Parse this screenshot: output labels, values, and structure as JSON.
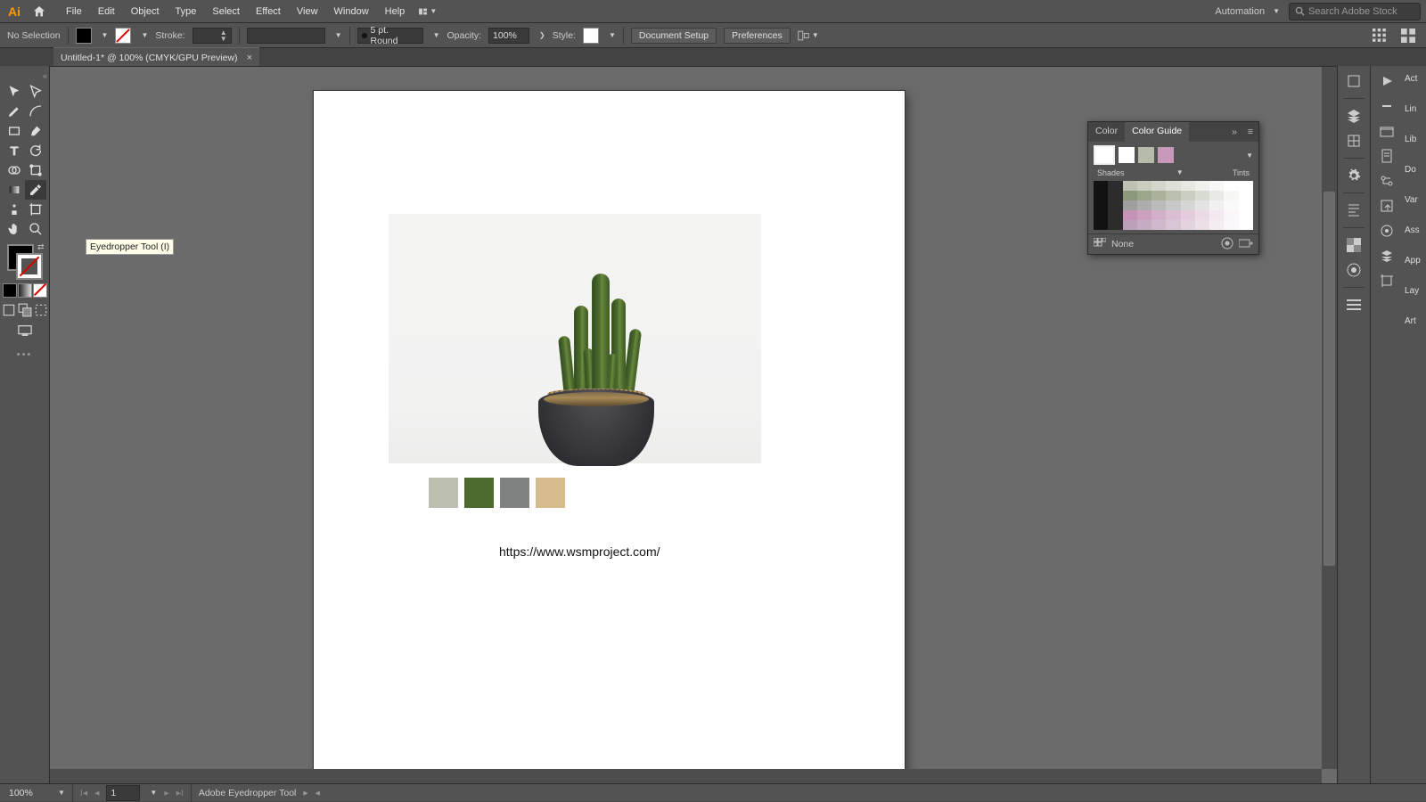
{
  "menubar": {
    "items": [
      "File",
      "Edit",
      "Object",
      "Type",
      "Select",
      "Effect",
      "View",
      "Window",
      "Help"
    ],
    "automation": "Automation",
    "search_placeholder": "Search Adobe Stock"
  },
  "controlbar": {
    "selection": "No Selection",
    "stroke_label": "Stroke:",
    "stroke_weight": "",
    "brush_profile": "5 pt. Round",
    "opacity_label": "Opacity:",
    "opacity_value": "100%",
    "style_label": "Style:",
    "doc_setup": "Document Setup",
    "preferences": "Preferences"
  },
  "tab": {
    "title": "Untitled-1* @ 100% (CMYK/GPU Preview)"
  },
  "tooltip": "Eyedropper Tool (I)",
  "document": {
    "swatches": [
      "#bcbfb0",
      "#4d6b2f",
      "#808281",
      "#d8bb8d"
    ],
    "url_text": "https://www.wsmproject.com/"
  },
  "color_guide": {
    "tab_color": "Color",
    "tab_guide": "Color Guide",
    "harmony_chips": [
      "#ffffff",
      "#b7bbaa",
      "#c999bb"
    ],
    "shades_label": "Shades",
    "tints_label": "Tints",
    "grid": [
      [
        "#121212",
        "#2c2c2c",
        "#bfc2b3",
        "#cacdbf",
        "#d4d6cb",
        "#dedfd6",
        "#e7e8e2",
        "#f0f1ed",
        "#f8f8f6",
        "#ffffff",
        "#ffffff"
      ],
      [
        "#121212",
        "#2c2c2c",
        "#8b9879",
        "#9aa58a",
        "#aab29c",
        "#b9c0ae",
        "#c9cec1",
        "#d8dcd3",
        "#e8eae5",
        "#f7f8f6",
        "#ffffff"
      ],
      [
        "#121212",
        "#2c2c2c",
        "#9f9f9f",
        "#adadad",
        "#bbbbbb",
        "#c8c8c8",
        "#d6d6d6",
        "#e3e3e3",
        "#f1f1f1",
        "#fafafa",
        "#ffffff"
      ],
      [
        "#121212",
        "#2c2c2c",
        "#c593b7",
        "#cca1c0",
        "#d4afc9",
        "#dcbed3",
        "#e4ccdc",
        "#ecdbe6",
        "#f4e9f0",
        "#fbf6f9",
        "#ffffff"
      ],
      [
        "#121212",
        "#2c2c2c",
        "#bca0ba",
        "#c5acc3",
        "#cfb9cc",
        "#d8c6d5",
        "#e2d3df",
        "#ebe0e8",
        "#f4edf1",
        "#fbf7fa",
        "#ffffff"
      ]
    ],
    "footer_text": "None"
  },
  "right_panels": [
    "Act",
    "Lin",
    "Lib",
    "Do",
    "Var",
    "Ass",
    "App",
    "Lay",
    "Art"
  ],
  "statusbar": {
    "zoom": "100%",
    "artboard_num": "1",
    "tool": "Adobe Eyedropper Tool"
  }
}
